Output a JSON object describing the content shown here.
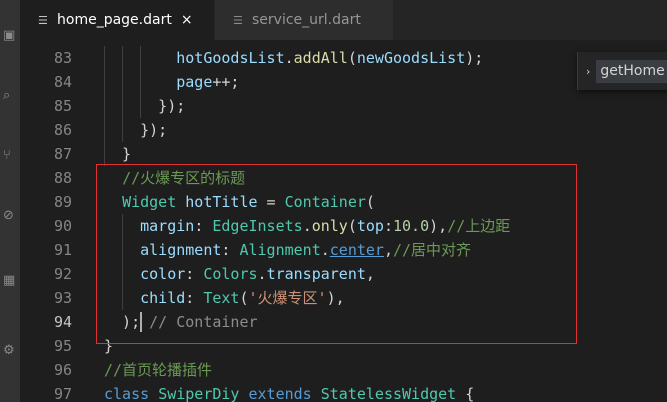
{
  "tabs": [
    {
      "label": "home_page.dart",
      "active": true,
      "icon": "file-lines-icon",
      "close": "×"
    },
    {
      "label": "service_url.dart",
      "active": false,
      "icon": "file-lines-icon"
    }
  ],
  "breadcrumb": {
    "chevron": "›",
    "label": "getHome"
  },
  "colors": {
    "background": "#1e1e1e",
    "function": "#dcdcaa",
    "variable": "#9cdcfe",
    "keyword": "#569cd6",
    "type": "#4ec9b0",
    "number": "#b5cea8",
    "string": "#ce9178",
    "comment": "#6a9955",
    "highlight_box": "#e03030"
  },
  "code": {
    "current_line": 94,
    "lines": [
      {
        "num": "83",
        "tokens": [
          {
            "t": "        ",
            "c": ""
          },
          {
            "t": "hotGoodsList",
            "c": "var"
          },
          {
            "t": ".",
            "c": ""
          },
          {
            "t": "addAll",
            "c": "fn"
          },
          {
            "t": "(",
            "c": ""
          },
          {
            "t": "newGoodsList",
            "c": "var"
          },
          {
            "t": ");",
            "c": ""
          }
        ]
      },
      {
        "num": "84",
        "tokens": [
          {
            "t": "        ",
            "c": ""
          },
          {
            "t": "page",
            "c": "var"
          },
          {
            "t": "++;",
            "c": ""
          }
        ]
      },
      {
        "num": "85",
        "tokens": [
          {
            "t": "      });",
            "c": ""
          }
        ]
      },
      {
        "num": "86",
        "tokens": [
          {
            "t": "    });",
            "c": ""
          }
        ]
      },
      {
        "num": "87",
        "tokens": [
          {
            "t": "  }",
            "c": ""
          }
        ]
      },
      {
        "num": "88",
        "tokens": [
          {
            "t": "  ",
            "c": ""
          },
          {
            "t": "//火爆专区的标题",
            "c": "comment"
          }
        ]
      },
      {
        "num": "89",
        "tokens": [
          {
            "t": "  ",
            "c": ""
          },
          {
            "t": "Widget",
            "c": "type"
          },
          {
            "t": " ",
            "c": ""
          },
          {
            "t": "hotTitle",
            "c": "var"
          },
          {
            "t": " = ",
            "c": ""
          },
          {
            "t": "Container",
            "c": "type"
          },
          {
            "t": "(",
            "c": ""
          }
        ]
      },
      {
        "num": "90",
        "tokens": [
          {
            "t": "    ",
            "c": ""
          },
          {
            "t": "margin",
            "c": "var"
          },
          {
            "t": ": ",
            "c": ""
          },
          {
            "t": "EdgeInsets",
            "c": "type"
          },
          {
            "t": ".",
            "c": ""
          },
          {
            "t": "only",
            "c": "fn"
          },
          {
            "t": "(",
            "c": ""
          },
          {
            "t": "top",
            "c": "var"
          },
          {
            "t": ":",
            "c": ""
          },
          {
            "t": "10.0",
            "c": "num"
          },
          {
            "t": "),",
            "c": ""
          },
          {
            "t": "//上边距",
            "c": "comment"
          }
        ]
      },
      {
        "num": "91",
        "tokens": [
          {
            "t": "    ",
            "c": ""
          },
          {
            "t": "alignment",
            "c": "var"
          },
          {
            "t": ": ",
            "c": ""
          },
          {
            "t": "Alignment",
            "c": "type"
          },
          {
            "t": ".",
            "c": ""
          },
          {
            "t": "center",
            "c": "link"
          },
          {
            "t": ",",
            "c": ""
          },
          {
            "t": "//居中对齐",
            "c": "comment"
          }
        ]
      },
      {
        "num": "92",
        "tokens": [
          {
            "t": "    ",
            "c": ""
          },
          {
            "t": "color",
            "c": "var"
          },
          {
            "t": ": ",
            "c": ""
          },
          {
            "t": "Colors",
            "c": "type"
          },
          {
            "t": ".",
            "c": ""
          },
          {
            "t": "transparent",
            "c": "var"
          },
          {
            "t": ",",
            "c": ""
          }
        ]
      },
      {
        "num": "93",
        "tokens": [
          {
            "t": "    ",
            "c": ""
          },
          {
            "t": "child",
            "c": "var"
          },
          {
            "t": ": ",
            "c": ""
          },
          {
            "t": "Text",
            "c": "type"
          },
          {
            "t": "(",
            "c": ""
          },
          {
            "t": "'火爆专区'",
            "c": "str"
          },
          {
            "t": "),",
            "c": ""
          }
        ]
      },
      {
        "num": "94",
        "tokens": [
          {
            "t": "  );",
            "c": ""
          },
          {
            "t": " // Container",
            "c": "hint"
          }
        ]
      },
      {
        "num": "95",
        "tokens": [
          {
            "t": "}",
            "c": ""
          }
        ]
      },
      {
        "num": "96",
        "tokens": [
          {
            "t": "//首页轮播插件",
            "c": "comment"
          }
        ]
      },
      {
        "num": "97",
        "tokens": [
          {
            "t": "class",
            "c": "kw"
          },
          {
            "t": " ",
            "c": ""
          },
          {
            "t": "SwiperDiy",
            "c": "type"
          },
          {
            "t": " ",
            "c": ""
          },
          {
            "t": "extends",
            "c": "kw"
          },
          {
            "t": " ",
            "c": ""
          },
          {
            "t": "StatelessWidget",
            "c": "type"
          },
          {
            "t": " {",
            "c": ""
          }
        ]
      }
    ]
  }
}
